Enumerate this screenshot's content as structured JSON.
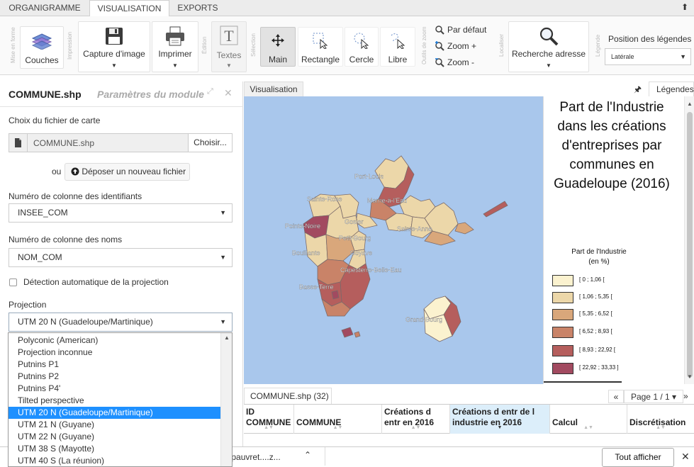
{
  "tabs": [
    "ORGANIGRAMME",
    "VISUALISATION",
    "EXPORTS"
  ],
  "ribbon": {
    "groups": [
      "Mise en forme",
      "Impression",
      "Édition",
      "Sélection",
      "Outils de zoom",
      "Localiser",
      "Légende"
    ],
    "buttons": {
      "couches": "Couches",
      "capture": "Capture d'image",
      "imprimer": "Imprimer",
      "textes": "Textes",
      "main": "Main",
      "rectangle": "Rectangle",
      "cercle": "Cercle",
      "libre": "Libre",
      "recherche": "Recherche adresse"
    },
    "zoom": {
      "default": "Par défaut",
      "plus": "Zoom +",
      "minus": "Zoom -"
    },
    "legend_position": {
      "title": "Position des légendes",
      "value": "Latérale"
    }
  },
  "panel": {
    "title": "COMMUNE.shp",
    "subtitle": "Paramètres du module",
    "file_label": "Choix du fichier de carte",
    "file_name": "COMMUNE.shp",
    "choose": "Choisir...",
    "or": "ou",
    "upload": "Déposer un nouveau fichier",
    "id_col_label": "Numéro de colonne des identifiants",
    "id_col_value": "INSEE_COM",
    "name_col_label": "Numéro de colonne des noms",
    "name_col_value": "NOM_COM",
    "auto_detect": "Détection automatique de la projection",
    "projection_label": "Projection",
    "projection_value": "UTM 20 N (Guadeloupe/Martinique)",
    "projection_options": [
      "Polyconic (American)",
      "Projection inconnue",
      "Putnins P1",
      "Putnins P2",
      "Putnins P4'",
      "Tilted perspective",
      "UTM 20 N (Guadeloupe/Martinique)",
      "UTM 21 N (Guyane)",
      "UTM 22 N (Guyane)",
      "UTM 38 S (Mayotte)",
      "UTM 40 S (La réunion)"
    ],
    "selected_option_index": 6
  },
  "map": {
    "tab": "Visualisation",
    "legend_tab": "Légendes",
    "place_labels": [
      "Port-Louis",
      "Sainte-Rose",
      "Morne-à-l'Eau",
      "Pointe-Noire",
      "Gosier",
      "Sainte-Anne",
      "Petit-Bourg",
      "Bouillante",
      "Goyave",
      "Capesterre-Belle-Eau",
      "Basse-Terre",
      "Grand-Bourg"
    ],
    "sea_color": "#a9c7ec"
  },
  "legend": {
    "title": "Part de l'Industrie dans les créations d'entreprises par communes en Guadeloupe (2016)",
    "subtitle_line1": "Part de l'Industrie",
    "subtitle_line2": "(en %)",
    "classes": [
      {
        "range": "[ 0 ; 1,06 [",
        "color": "#fbf2cf"
      },
      {
        "range": "[ 1,06 ; 5,35 [",
        "color": "#ecd7a9"
      },
      {
        "range": "[ 5,35 ; 6,52 [",
        "color": "#d9a77b"
      },
      {
        "range": "[ 6,52 ; 8,93 [",
        "color": "#c98368"
      },
      {
        "range": "[ 8,93 ; 22,92 [",
        "color": "#b55e5d"
      },
      {
        "range": "[ 22,92 ; 33,33 ]",
        "color": "#a24a60"
      }
    ]
  },
  "table": {
    "tab": "COMMUNE.shp (32)",
    "pager_prev": "«",
    "pager": "Page 1 / 1 ▾",
    "pager_next": "»",
    "columns": [
      {
        "l1": "ID",
        "l2": "COMMUNE"
      },
      {
        "l1": "",
        "l2": "COMMUNE"
      },
      {
        "l1": "Créations d",
        "l2": "entr en 2016"
      },
      {
        "l1": "Créations d entr de l",
        "l2": "industrie en 2016"
      },
      {
        "l1": "",
        "l2": "Calcul"
      },
      {
        "l1": "",
        "l2": "Discrétisation"
      }
    ]
  },
  "bottom": {
    "download_file": "nu-pauvret....z...",
    "show_all": "Tout afficher"
  }
}
